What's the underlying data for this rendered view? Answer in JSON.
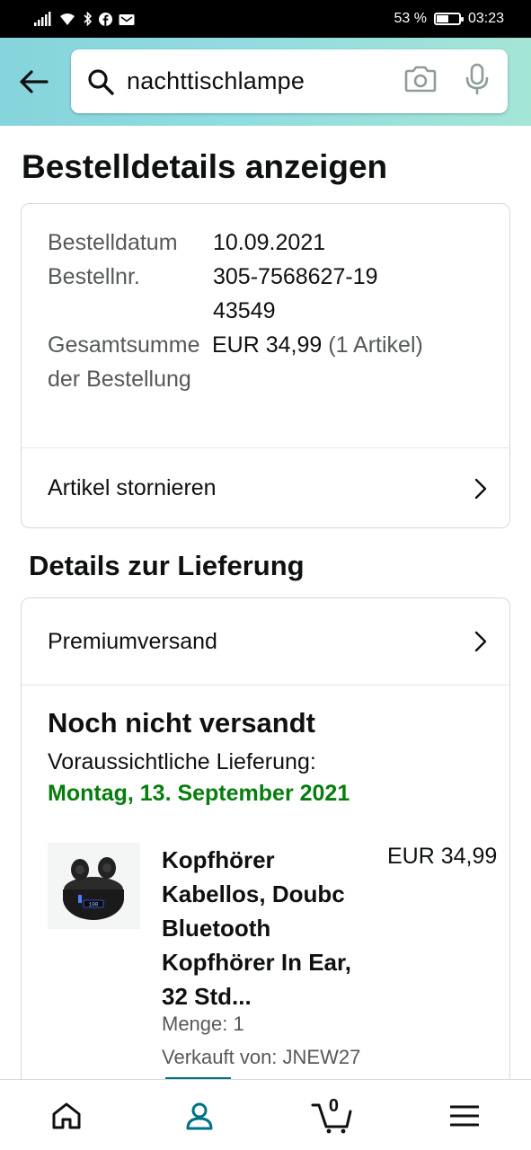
{
  "status_bar": {
    "battery_text": "53 %",
    "battery_level": 0.53,
    "time": "03:23"
  },
  "header": {
    "search_query": "nachttischlampe"
  },
  "page_title": "Bestelldetails anzeigen",
  "order_summary": {
    "date_label": "Bestelldatum",
    "date_value": "10.09.2021",
    "number_label": "Bestellnr.",
    "number_value": "305-7568627-1943549",
    "total_label": "Gesamtsumme der Bestellung",
    "total_value": "EUR 34,99",
    "total_count": "(1 Artikel)",
    "cancel_label": "Artikel stornieren"
  },
  "delivery": {
    "section_title": "Details zur Lieferung",
    "shipping_method": "Premiumversand",
    "status": "Noch nicht versandt",
    "expected_label": "Voraussichtliche Lieferung:",
    "expected_date": "Montag, 13. September 2021"
  },
  "item": {
    "title": "Kopfhörer Kabellos, Doubc Bluetooth Kopfhörer In Ear, 32 Std...",
    "price": "EUR 34,99",
    "quantity": "Menge: 1",
    "seller": "Verkauft von: JNEW27",
    "thumb_display": "100"
  },
  "bottom_nav": {
    "active": "account",
    "cart_count": "0"
  },
  "colors": {
    "header_gradient_start": "#86d4dc",
    "header_gradient_end": "#a4e6d6",
    "delivery_green": "#067d0d",
    "active_indicator": "#007185"
  }
}
